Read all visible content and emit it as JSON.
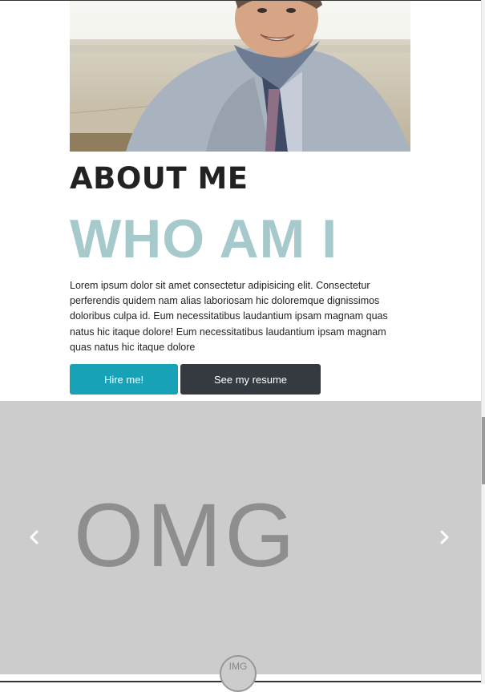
{
  "about": {
    "photo_alt": "man smiling in scarf",
    "heading": "ABOUT ME",
    "subheading": "WHO AM I",
    "bio": "Lorem ipsum dolor sit amet consectetur adipisicing elit. Consectetur perferendis quidem nam alias laboriosam hic doloremque dignissimos doloribus culpa id. Eum necessitatibus laudantium ipsam magnam quas natus hic itaque dolore! Eum necessitatibus laudantium ipsam magnam quas natus hic itaque dolore",
    "buttons": {
      "hire": "Hire me!",
      "resume": "See my resume"
    }
  },
  "carousel": {
    "slide_text": "OMG",
    "prev_icon": "chevron-left-icon",
    "next_icon": "chevron-right-icon"
  },
  "avatar": {
    "label": "IMG"
  },
  "colors": {
    "subheading": "#a6c9cc",
    "hire_button": "#17a2b8",
    "resume_button": "#343a40",
    "carousel_bg": "#cccccc"
  }
}
